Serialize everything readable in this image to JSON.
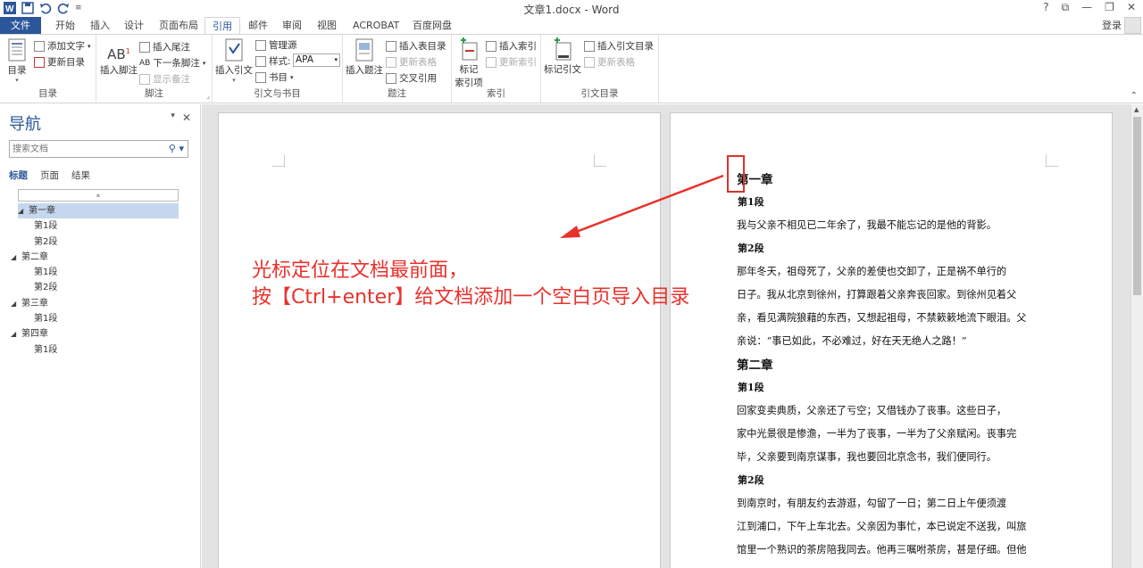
{
  "app": {
    "window_title": "文章1.docx - Word",
    "window_controls": [
      "?",
      "⧉",
      "—",
      "❐",
      "✕"
    ],
    "login_label": "登录"
  },
  "tabs": [
    {
      "label": "文件",
      "active": false
    },
    {
      "label": "开始",
      "active": false
    },
    {
      "label": "插入",
      "active": false
    },
    {
      "label": "设计",
      "active": false
    },
    {
      "label": "页面布局",
      "active": false
    },
    {
      "label": "引用",
      "active": true
    },
    {
      "label": "邮件",
      "active": false
    },
    {
      "label": "审阅",
      "active": false
    },
    {
      "label": "视图",
      "active": false
    },
    {
      "label": "ACROBAT",
      "active": false
    },
    {
      "label": "百度网盘",
      "active": false
    }
  ],
  "ribbon": {
    "toc_group": {
      "label": "目录",
      "toc_button": "目录",
      "add_text": "添加文字",
      "update_toc": "更新目录"
    },
    "footnote_group": {
      "label": "脚注",
      "insert_footnote": "插入脚注",
      "insert_endnote": "插入尾注",
      "next_footnote": "下一条脚注",
      "show_notes": "显示备注"
    },
    "citation_group": {
      "label": "引文与书目",
      "insert_citation": "插入引文",
      "manage_sources": "管理源",
      "style_label": "样式:",
      "style_value": "APA",
      "bibliography": "书目"
    },
    "caption_group": {
      "label": "题注",
      "insert_caption": "插入题注",
      "insert_table_of_figures": "插入表目录",
      "update_table": "更新表格",
      "cross_reference": "交叉引用"
    },
    "index_group": {
      "label": "索引",
      "mark_entry_line1": "标记",
      "mark_entry_line2": "索引项",
      "insert_index": "插入索引",
      "update_index": "更新索引"
    },
    "authorities_group": {
      "label": "引文目录",
      "mark_citation": "标记引文",
      "insert_table_of_authorities": "插入引文目录",
      "update_table": "更新表格"
    }
  },
  "nav": {
    "title": "导航",
    "search_placeholder": "搜索文档",
    "tabs": [
      "标题",
      "页面",
      "结果"
    ],
    "active_tab": "标题",
    "tree": [
      {
        "label": "第一章",
        "level": 1,
        "selected": true
      },
      {
        "label": "第1段",
        "level": 2
      },
      {
        "label": "第2段",
        "level": 2
      },
      {
        "label": "第二章",
        "level": 1
      },
      {
        "label": "第1段",
        "level": 2
      },
      {
        "label": "第2段",
        "level": 2
      },
      {
        "label": "第三章",
        "level": 1
      },
      {
        "label": "第1段",
        "level": 2
      },
      {
        "label": "第四章",
        "level": 1
      },
      {
        "label": "第1段",
        "level": 2
      }
    ]
  },
  "annotation": {
    "line1": "光标定位在文档最前面，",
    "line2": "按【Ctrl+enter】给文档添加一个空白页导入目录"
  },
  "document": {
    "blocks": [
      {
        "type": "chapter",
        "text": "第一章"
      },
      {
        "type": "section",
        "text": "第1段"
      },
      {
        "type": "para",
        "text": "    我与父亲不相见已二年余了，我最不能忘记的是他的背影。"
      },
      {
        "type": "section",
        "text": "第2段"
      },
      {
        "type": "para",
        "text": "    那年冬天，祖母死了，父亲的差使也交卸了，正是祸不单行的"
      },
      {
        "type": "para",
        "text": "日子。我从北京到徐州，打算跟着父亲奔丧回家。到徐州见着父"
      },
      {
        "type": "para",
        "text": "亲，看见满院狼藉的东西，又想起祖母，不禁簌簌地流下眼泪。父"
      },
      {
        "type": "para",
        "text": "亲说：“事已如此，不必难过，好在天无绝人之路！”"
      },
      {
        "type": "chapter",
        "text": "第二章"
      },
      {
        "type": "section",
        "text": "第1段"
      },
      {
        "type": "para",
        "text": "    回家变卖典质，父亲还了亏空；又借钱办了丧事。这些日子，"
      },
      {
        "type": "para",
        "text": "家中光景很是惨澹，一半为了丧事，一半为了父亲赋闲。丧事完"
      },
      {
        "type": "para",
        "text": "毕，父亲要到南京谋事，我也要回北京念书，我们便同行。"
      },
      {
        "type": "section",
        "text": "第2段"
      },
      {
        "type": "para",
        "text": "    到南京时，有朋友约去游逛，勾留了一日；第二日上午便须渡"
      },
      {
        "type": "para",
        "text": "江到浦口，下午上车北去。父亲因为事忙，本已说定不送我，叫旅"
      },
      {
        "type": "para",
        "text": "馆里一个熟识的茶房陪我同去。他再三嘱咐茶房，甚是仔细。但他"
      }
    ]
  },
  "colors": {
    "accent": "#2b579a",
    "annotation": "#e8322c"
  }
}
